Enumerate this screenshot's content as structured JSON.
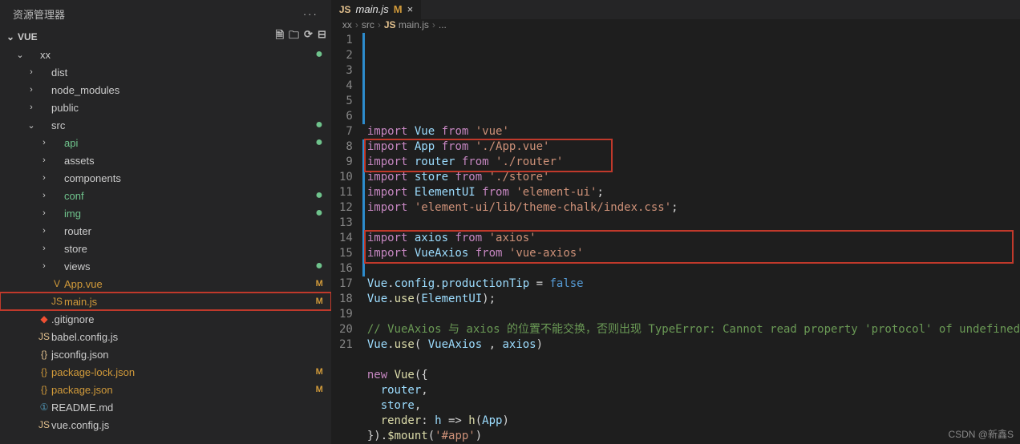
{
  "sidebar": {
    "title": "资源管理器",
    "section": "VUE",
    "icons": [
      "new-file",
      "new-folder",
      "refresh",
      "collapse"
    ],
    "tree": [
      {
        "type": "folder",
        "label": "xx",
        "indent": 1,
        "open": true,
        "status": "dot"
      },
      {
        "type": "folder",
        "label": "dist",
        "indent": 2,
        "closed": true
      },
      {
        "type": "folder",
        "label": "node_modules",
        "indent": 2,
        "closed": true
      },
      {
        "type": "folder",
        "label": "public",
        "indent": 2,
        "closed": true
      },
      {
        "type": "folder",
        "label": "src",
        "indent": 2,
        "open": true,
        "status": "dot"
      },
      {
        "type": "folder",
        "label": "api",
        "indent": 3,
        "closed": true,
        "git": "unt",
        "status": "dot"
      },
      {
        "type": "folder",
        "label": "assets",
        "indent": 3,
        "closed": true
      },
      {
        "type": "folder",
        "label": "components",
        "indent": 3,
        "closed": true
      },
      {
        "type": "folder",
        "label": "conf",
        "indent": 3,
        "closed": true,
        "git": "unt",
        "status": "dot"
      },
      {
        "type": "folder",
        "label": "img",
        "indent": 3,
        "closed": true,
        "git": "unt",
        "status": "dot"
      },
      {
        "type": "folder",
        "label": "router",
        "indent": 3,
        "closed": true
      },
      {
        "type": "folder",
        "label": "store",
        "indent": 3,
        "closed": true
      },
      {
        "type": "folder",
        "label": "views",
        "indent": 3,
        "closed": true,
        "status": "dot"
      },
      {
        "type": "file",
        "label": "App.vue",
        "indent": 3,
        "icon": "vue",
        "git": "mod",
        "status": "M"
      },
      {
        "type": "file",
        "label": "main.js",
        "indent": 3,
        "icon": "js",
        "git": "mod",
        "status": "M",
        "selected": true
      },
      {
        "type": "file",
        "label": ".gitignore",
        "indent": 2,
        "icon": "git"
      },
      {
        "type": "file",
        "label": "babel.config.js",
        "indent": 2,
        "icon": "js"
      },
      {
        "type": "file",
        "label": "jsconfig.json",
        "indent": 2,
        "icon": "json"
      },
      {
        "type": "file",
        "label": "package-lock.json",
        "indent": 2,
        "icon": "json",
        "git": "mod",
        "status": "M"
      },
      {
        "type": "file",
        "label": "package.json",
        "indent": 2,
        "icon": "json",
        "git": "mod",
        "status": "M"
      },
      {
        "type": "file",
        "label": "README.md",
        "indent": 2,
        "icon": "md"
      },
      {
        "type": "file",
        "label": "vue.config.js",
        "indent": 2,
        "icon": "js"
      }
    ]
  },
  "tab": {
    "icon": "JS",
    "label": "main.js",
    "status": "M",
    "close": "×"
  },
  "crumbs": [
    "xx",
    "src",
    "main.js",
    "..."
  ],
  "code": {
    "lines": [
      {
        "n": 1,
        "t": [
          [
            "kw",
            "import"
          ],
          [
            "pl",
            " "
          ],
          [
            "var",
            "Vue"
          ],
          [
            "pl",
            " "
          ],
          [
            "kw",
            "from"
          ],
          [
            "pl",
            " "
          ],
          [
            "str",
            "'vue'"
          ]
        ]
      },
      {
        "n": 2,
        "t": [
          [
            "kw",
            "import"
          ],
          [
            "pl",
            " "
          ],
          [
            "var",
            "App"
          ],
          [
            "pl",
            " "
          ],
          [
            "kw",
            "from"
          ],
          [
            "pl",
            " "
          ],
          [
            "str",
            "'./App.vue'"
          ]
        ]
      },
      {
        "n": 3,
        "t": [
          [
            "kw",
            "import"
          ],
          [
            "pl",
            " "
          ],
          [
            "var",
            "router"
          ],
          [
            "pl",
            " "
          ],
          [
            "kw",
            "from"
          ],
          [
            "pl",
            " "
          ],
          [
            "str",
            "'./router'"
          ]
        ]
      },
      {
        "n": 4,
        "t": [
          [
            "kw",
            "import"
          ],
          [
            "pl",
            " "
          ],
          [
            "var",
            "store"
          ],
          [
            "pl",
            " "
          ],
          [
            "kw",
            "from"
          ],
          [
            "pl",
            " "
          ],
          [
            "str",
            "'./store'"
          ]
        ]
      },
      {
        "n": 5,
        "t": [
          [
            "kw",
            "import"
          ],
          [
            "pl",
            " "
          ],
          [
            "var",
            "ElementUI"
          ],
          [
            "pl",
            " "
          ],
          [
            "kw",
            "from"
          ],
          [
            "pl",
            " "
          ],
          [
            "str",
            "'element-ui'"
          ],
          [
            "pl",
            ";"
          ]
        ]
      },
      {
        "n": 6,
        "t": [
          [
            "kw",
            "import"
          ],
          [
            "pl",
            " "
          ],
          [
            "str",
            "'element-ui/lib/theme-chalk/index.css'"
          ],
          [
            "pl",
            ";"
          ]
        ]
      },
      {
        "n": 7,
        "t": []
      },
      {
        "n": 8,
        "t": [
          [
            "kw",
            "import"
          ],
          [
            "pl",
            " "
          ],
          [
            "var",
            "axios"
          ],
          [
            "pl",
            " "
          ],
          [
            "kw",
            "from"
          ],
          [
            "pl",
            " "
          ],
          [
            "str",
            "'axios'"
          ]
        ]
      },
      {
        "n": 9,
        "t": [
          [
            "kw",
            "import"
          ],
          [
            "pl",
            " "
          ],
          [
            "var",
            "VueAxios"
          ],
          [
            "pl",
            " "
          ],
          [
            "kw",
            "from"
          ],
          [
            "pl",
            " "
          ],
          [
            "str",
            "'vue-axios'"
          ]
        ]
      },
      {
        "n": 10,
        "t": []
      },
      {
        "n": 11,
        "t": [
          [
            "var",
            "Vue"
          ],
          [
            "pl",
            "."
          ],
          [
            "prop",
            "config"
          ],
          [
            "pl",
            "."
          ],
          [
            "prop",
            "productionTip"
          ],
          [
            "pl",
            " = "
          ],
          [
            "bool",
            "false"
          ]
        ]
      },
      {
        "n": 12,
        "t": [
          [
            "var",
            "Vue"
          ],
          [
            "pl",
            "."
          ],
          [
            "fn",
            "use"
          ],
          [
            "pl",
            "("
          ],
          [
            "var",
            "ElementUI"
          ],
          [
            "pl",
            ");"
          ]
        ]
      },
      {
        "n": 13,
        "t": []
      },
      {
        "n": 14,
        "t": [
          [
            "cm",
            "// VueAxios 与 axios 的位置不能交换，否则出现 TypeError: Cannot read property 'protocol' of undefined"
          ]
        ]
      },
      {
        "n": 15,
        "t": [
          [
            "var",
            "Vue"
          ],
          [
            "pl",
            "."
          ],
          [
            "fn",
            "use"
          ],
          [
            "pl",
            "( "
          ],
          [
            "var",
            "VueAxios"
          ],
          [
            "pl",
            " , "
          ],
          [
            "var",
            "axios"
          ],
          [
            "pl",
            ")"
          ]
        ]
      },
      {
        "n": 16,
        "t": []
      },
      {
        "n": 17,
        "t": [
          [
            "kw",
            "new"
          ],
          [
            "pl",
            " "
          ],
          [
            "fn",
            "Vue"
          ],
          [
            "pl",
            "({"
          ]
        ]
      },
      {
        "n": 18,
        "t": [
          [
            "pl",
            "  "
          ],
          [
            "prop",
            "router"
          ],
          [
            "pl",
            ","
          ]
        ]
      },
      {
        "n": 19,
        "t": [
          [
            "pl",
            "  "
          ],
          [
            "prop",
            "store"
          ],
          [
            "pl",
            ","
          ]
        ]
      },
      {
        "n": 20,
        "t": [
          [
            "pl",
            "  "
          ],
          [
            "fn",
            "render"
          ],
          [
            "pl",
            ": "
          ],
          [
            "var",
            "h"
          ],
          [
            "pl",
            " => "
          ],
          [
            "fn",
            "h"
          ],
          [
            "pl",
            "("
          ],
          [
            "var",
            "App"
          ],
          [
            "pl",
            ")"
          ]
        ]
      },
      {
        "n": 21,
        "t": [
          [
            "pl",
            "})."
          ],
          [
            "fn",
            "$mount"
          ],
          [
            "pl",
            "("
          ],
          [
            "str",
            "'#app'"
          ],
          [
            "pl",
            ")"
          ]
        ]
      }
    ]
  },
  "watermark": "CSDN @新鑫S"
}
